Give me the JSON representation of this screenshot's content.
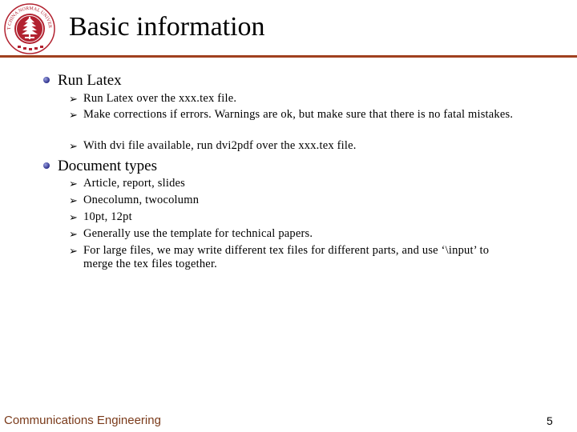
{
  "header": {
    "logo_text": "EAST CHINA NORMAL UNIVERSITY",
    "title": "Basic information"
  },
  "colors": {
    "rule": "#a0401f",
    "logo_red": "#b22230",
    "footer_text": "#7a3a1a",
    "bullet": "#2c2f8a"
  },
  "sections": [
    {
      "heading": "Run Latex",
      "icon": "bullet-dot-icon",
      "items": [
        "Run Latex over the xxx.tex file.",
        "Make corrections if errors. Warnings are ok, but make sure that there is no fatal mistakes.",
        "With dvi file available, run dvi2pdf over the xxx.tex file."
      ]
    },
    {
      "heading": "Document types",
      "icon": "bullet-dot-icon",
      "items": [
        "Article, report, slides",
        "Onecolumn, twocolumn",
        "10pt, 12pt",
        "Generally use the template for technical papers.",
        "For large files, we may write different tex files for different parts, and use ‘\\input’ to merge the tex files together."
      ]
    }
  ],
  "footer": {
    "left": "Communications Engineering",
    "page_number": "5"
  },
  "sub_bullet_glyph": "➢"
}
